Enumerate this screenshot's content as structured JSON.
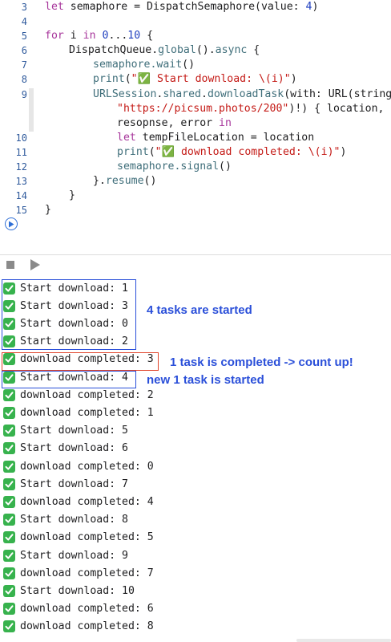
{
  "editor": {
    "line_numbers": [
      "3",
      "4",
      "5",
      "6",
      "7",
      "8",
      "9",
      "",
      "",
      "10",
      "11",
      "12",
      "13",
      "14",
      "15"
    ],
    "lines": {
      "l3": {
        "kw": "let",
        "rest": " semaphore = DispatchSemaphore(value: ",
        "num": "4",
        "end": ")"
      },
      "l5": {
        "kw1": "for",
        "mid1": " i ",
        "kw2": "in",
        "sp": " ",
        "num1": "0",
        "dots": "...",
        "num2": "10",
        "end": " {"
      },
      "l6": {
        "ty": "DispatchQueue",
        "dot": ".",
        "fn1": "global",
        "mid": "().",
        "fn2": "async",
        "end": " {"
      },
      "l7": {
        "pre": "semaphore.",
        "fn": "wait",
        "end": "()"
      },
      "l8": {
        "fn": "print",
        "p1": "(",
        "str": "\"✅ Start download: \\(i)\"",
        "end": ")"
      },
      "l9": {
        "ty": "URLSession",
        "p1": ".",
        "fn1": "shared",
        "p2": ".",
        "fn2": "downloadTask",
        "p3": "(with: URL(string:"
      },
      "l9b": {
        "str": "\"https://picsum.photos/200\"",
        "end": ")!) { location,"
      },
      "l9c": {
        "pre": "resopnse, error ",
        "kw": "in"
      },
      "l10": {
        "kw": "let",
        "rest": " tempFileLocation = location"
      },
      "l11": {
        "fn": "print",
        "p1": "(",
        "str": "\"✅ download completed: \\(i)\"",
        "end": ")"
      },
      "l12": {
        "pre": "semaphore.",
        "fn": "signal",
        "end": "()"
      },
      "l13": {
        "pre": "}.",
        "fn": "resume",
        "end": "()"
      },
      "l14": {
        "text": "}"
      },
      "l15": {
        "text": "}"
      }
    }
  },
  "toolbar": {
    "stop_icon": "stop-icon",
    "play_icon": "play-icon"
  },
  "console": {
    "lines": [
      "Start download: 1",
      "Start download: 3",
      "Start download: 0",
      "Start download: 2",
      "download completed: 3",
      "Start download: 4",
      "download completed: 2",
      "download completed: 1",
      "Start download: 5",
      "Start download: 6",
      "download completed: 0",
      "Start download: 7",
      "download completed: 4",
      "Start download: 8",
      "download completed: 5",
      "Start download: 9",
      "download completed: 7",
      "Start download: 10",
      "download completed: 6",
      "download completed: 8"
    ]
  },
  "annotations": {
    "tasks_started": "4 tasks are started",
    "task_completed": "1 task is completed -> count up!",
    "new_task": "new 1 task is started"
  },
  "colors": {
    "annotation_blue": "#2a4fd9",
    "annotation_red": "#e0452b",
    "check_green": "#37b24d",
    "keyword": "#a7369b",
    "string": "#c41a16",
    "number": "#1f3fbf"
  }
}
